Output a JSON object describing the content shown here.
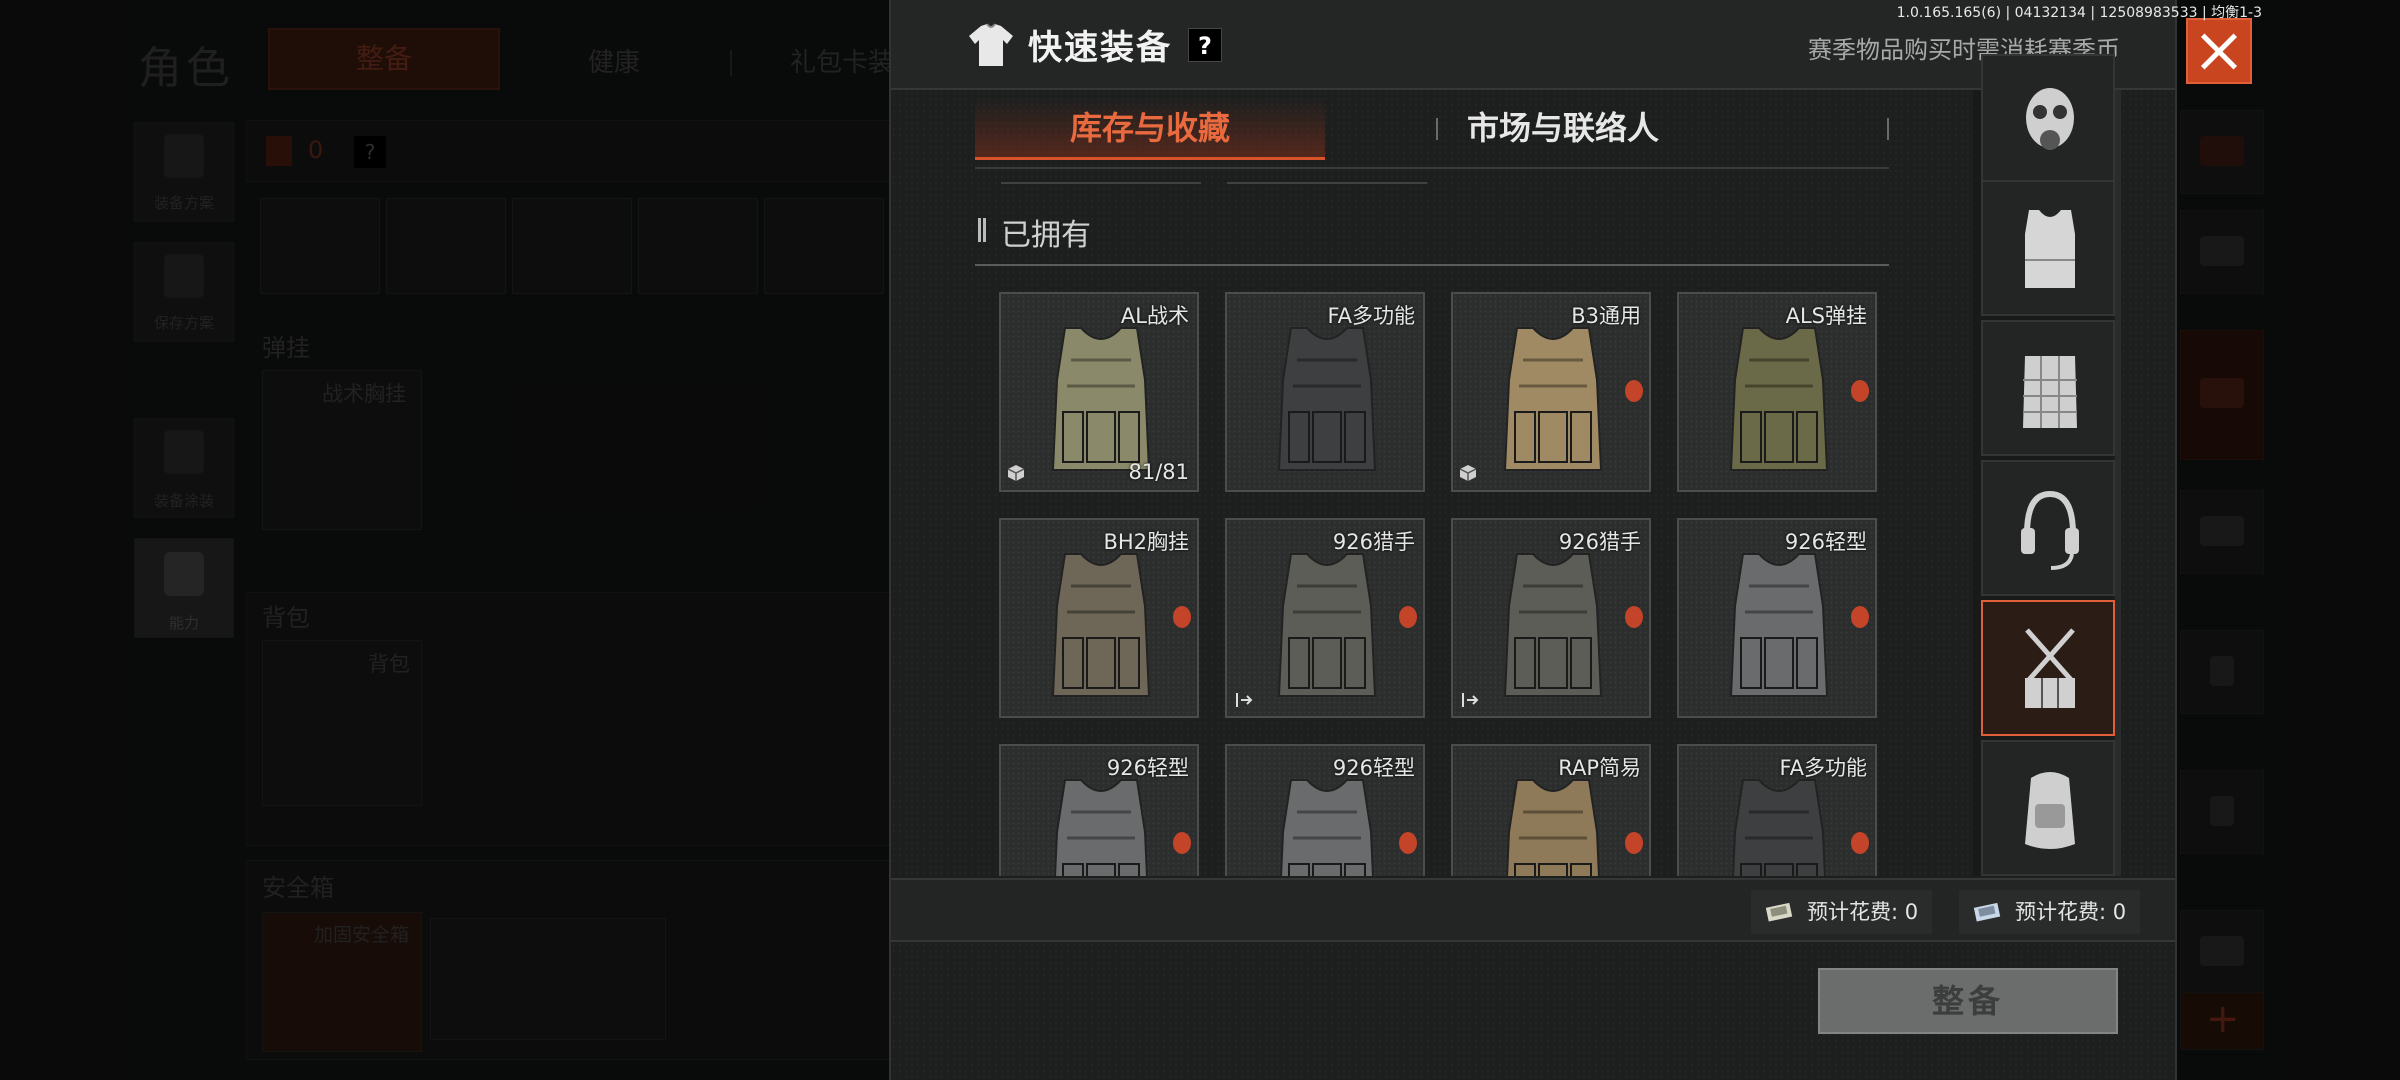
{
  "version": "1.0.165.165(6) | 04132134 | 12508983533 | 均衡1-3",
  "background": {
    "title": "角色",
    "tabs": [
      "整备",
      "健康",
      "礼包卡装"
    ],
    "left_menu": [
      "装备方案",
      "保存方案",
      "装备涂装",
      "能力"
    ],
    "count": "0",
    "sections": {
      "vest": "弹挂",
      "vest_slot": "战术胸挂",
      "backpack": "背包",
      "backpack_slot": "背包",
      "safebox": "安全箱",
      "safebox_slot": "加固安全箱"
    }
  },
  "modal": {
    "title": "快速装备",
    "help": "?",
    "note": "赛季物品购买时需消耗赛季币",
    "tabs": [
      {
        "label": "库存与收藏",
        "active": true
      },
      {
        "label": "市场与联络人",
        "active": false
      }
    ],
    "section_title": "已拥有",
    "items": [
      {
        "name": "AL战术",
        "count": "81/81",
        "marker": "cube",
        "badge": false,
        "color": "#8a8a6a"
      },
      {
        "name": "FA多功能",
        "count": "",
        "marker": "",
        "badge": false,
        "color": "#3e3f40"
      },
      {
        "name": "B3通用",
        "count": "",
        "marker": "cube",
        "badge": true,
        "color": "#a08a64"
      },
      {
        "name": "ALS弹挂",
        "count": "",
        "marker": "",
        "badge": true,
        "color": "#6b6a48"
      },
      {
        "name": "BH2胸挂",
        "count": "",
        "marker": "",
        "badge": true,
        "color": "#6e6656"
      },
      {
        "name": "926猎手",
        "count": "",
        "marker": "exit",
        "badge": true,
        "color": "#5d5d58"
      },
      {
        "name": "926猎手",
        "count": "",
        "marker": "exit",
        "badge": true,
        "color": "#5d5d58"
      },
      {
        "name": "926轻型",
        "count": "",
        "marker": "",
        "badge": true,
        "color": "#6a6b6c"
      },
      {
        "name": "926轻型",
        "count": "",
        "marker": "",
        "badge": true,
        "color": "#6a6b6c"
      },
      {
        "name": "926轻型",
        "count": "",
        "marker": "",
        "badge": true,
        "color": "#6a6b6c"
      },
      {
        "name": "RAP简易",
        "count": "",
        "marker": "",
        "badge": true,
        "color": "#8e7a58"
      },
      {
        "name": "FA多功能",
        "count": "",
        "marker": "",
        "badge": true,
        "color": "#3e3f40"
      }
    ],
    "categories": [
      "gas-mask",
      "body-armor",
      "chest-rig-plate",
      "headset",
      "chest-rig",
      "backpack"
    ],
    "active_category": "chest-rig",
    "costs": [
      {
        "label": "预计花费: 0",
        "icon": "cash-icon"
      },
      {
        "label": "预计花费: 0",
        "icon": "coin-icon"
      }
    ],
    "equip_button": "整备"
  }
}
